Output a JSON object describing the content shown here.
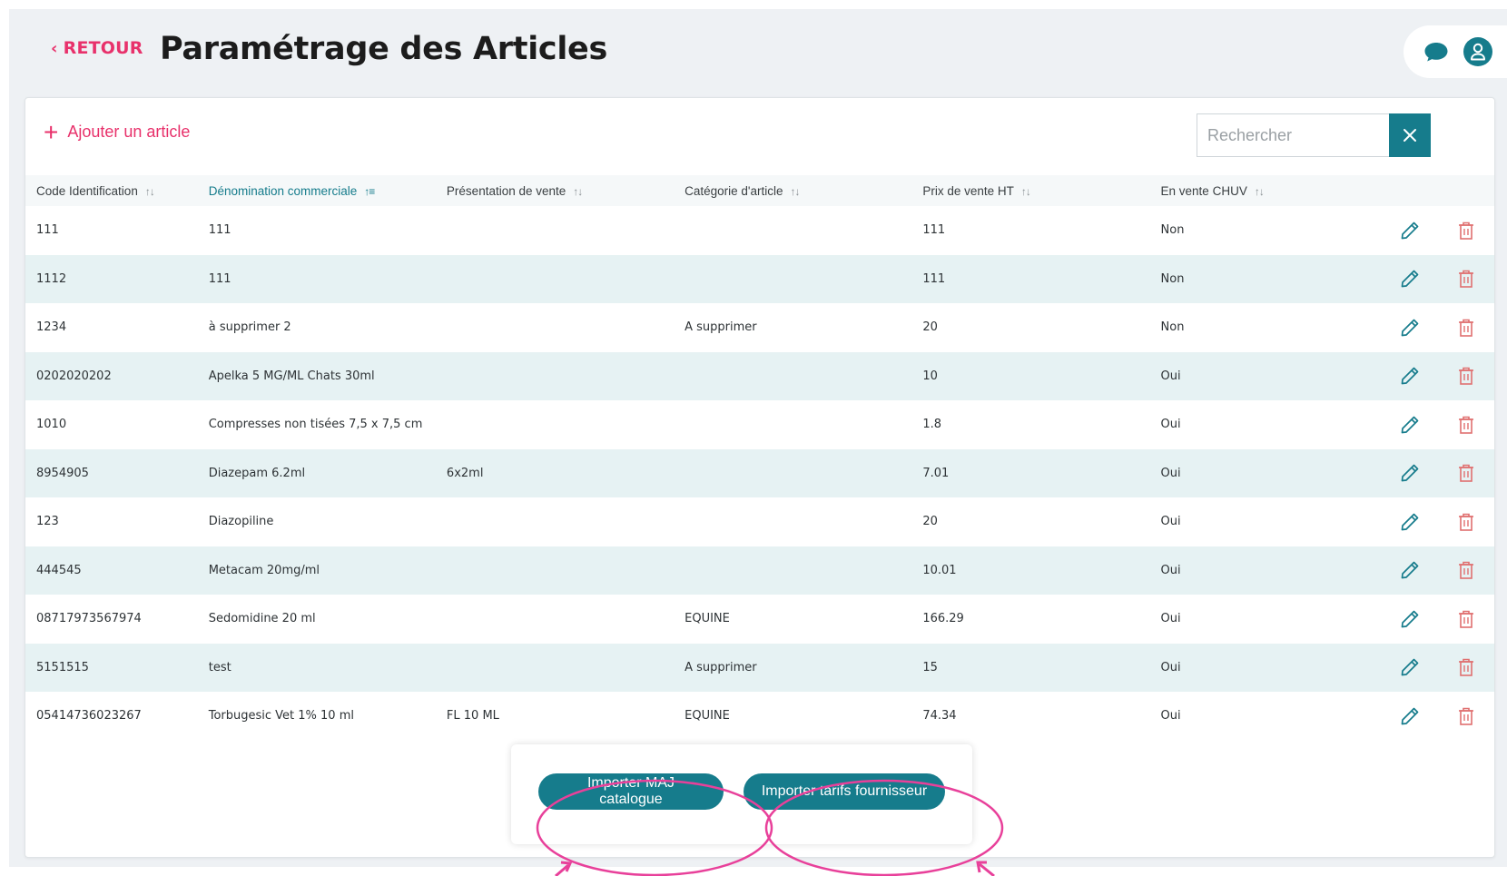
{
  "header": {
    "back_label": "RETOUR",
    "title": "Paramétrage des Articles",
    "chat_icon": "chat-bubble-icon",
    "user_icon": "user-icon"
  },
  "toolbar": {
    "add_label": "Ajouter un article",
    "search_placeholder": "Rechercher",
    "search_value": ""
  },
  "table": {
    "columns": [
      "Code Identification",
      "Dénomination commerciale",
      "Présentation de vente",
      "Catégorie d'article",
      "Prix de vente HT",
      "En vente CHUV"
    ],
    "sorted_column": "Dénomination commerciale",
    "rows": [
      {
        "code": "111",
        "name": "111",
        "presentation": "",
        "category": "",
        "price": "111",
        "on_sale": "Non"
      },
      {
        "code": "1112",
        "name": "111",
        "presentation": "",
        "category": "",
        "price": "111",
        "on_sale": "Non"
      },
      {
        "code": "1234",
        "name": "à supprimer 2",
        "presentation": "",
        "category": "A supprimer",
        "price": "20",
        "on_sale": "Non"
      },
      {
        "code": "0202020202",
        "name": "Apelka 5 MG/ML Chats 30ml",
        "presentation": "",
        "category": "",
        "price": "10",
        "on_sale": "Oui"
      },
      {
        "code": "1010",
        "name": "Compresses non tisées 7,5 x 7,5 cm",
        "presentation": "",
        "category": "",
        "price": "1.8",
        "on_sale": "Oui"
      },
      {
        "code": "8954905",
        "name": "Diazepam 6.2ml",
        "presentation": "6x2ml",
        "category": "",
        "price": "7.01",
        "on_sale": "Oui"
      },
      {
        "code": "123",
        "name": "Diazopiline",
        "presentation": "",
        "category": "",
        "price": "20",
        "on_sale": "Oui"
      },
      {
        "code": "444545",
        "name": "Metacam 20mg/ml",
        "presentation": "",
        "category": "",
        "price": "10.01",
        "on_sale": "Oui"
      },
      {
        "code": "08717973567974",
        "name": "Sedomidine 20 ml",
        "presentation": "",
        "category": "EQUINE",
        "price": "166.29",
        "on_sale": "Oui"
      },
      {
        "code": "5151515",
        "name": "test",
        "presentation": "",
        "category": "A supprimer",
        "price": "15",
        "on_sale": "Oui"
      },
      {
        "code": "05414736023267",
        "name": "Torbugesic Vet 1% 10 ml",
        "presentation": "FL 10 ML",
        "category": "EQUINE",
        "price": "74.34",
        "on_sale": "Oui"
      }
    ],
    "row_actions": {
      "edit_icon": "pencil-icon",
      "delete_icon": "trash-icon"
    }
  },
  "import_bar": {
    "catalogue_label": "Importer MAJ catalogue",
    "supplier_label": "Importer tarifs fournisseur"
  },
  "colors": {
    "accent": "#e8316b",
    "primary": "#167c8c",
    "row_alt": "#e6f2f3",
    "annotation": "#e8409a",
    "delete": "#e07070"
  }
}
